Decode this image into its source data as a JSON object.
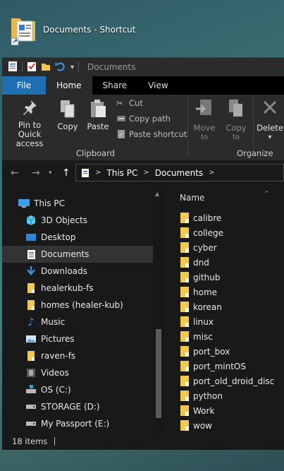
{
  "desktop": {
    "shortcut_label": "Documents - Shortcut"
  },
  "window": {
    "path_title": "Documents"
  },
  "tabs": [
    {
      "label": "File"
    },
    {
      "label": "Home"
    },
    {
      "label": "Share"
    },
    {
      "label": "View"
    }
  ],
  "ribbon": {
    "pin": "Pin to Quick access",
    "copy": "Copy",
    "paste": "Paste",
    "cut": "Cut",
    "copy_path": "Copy path",
    "paste_shortcut": "Paste shortcut",
    "clipboard": "Clipboard",
    "move_to": "Move",
    "move_to2": "to",
    "copy_to": "Copy",
    "copy_to2": "to",
    "delete": "Delete",
    "organize": "Organize"
  },
  "breadcrumb": [
    "This PC",
    "Documents"
  ],
  "tree": [
    {
      "label": "This PC",
      "icon": "pc-icon"
    },
    {
      "label": "3D Objects",
      "icon": "3d-objects-icon"
    },
    {
      "label": "Desktop",
      "icon": "desktop-icon"
    },
    {
      "label": "Documents",
      "icon": "documents-icon"
    },
    {
      "label": "Downloads",
      "icon": "download-icon"
    },
    {
      "label": "healerkub-fs",
      "icon": "folder-icon"
    },
    {
      "label": "homes (healer-kub)",
      "icon": "folder-icon"
    },
    {
      "label": "Music",
      "icon": "music-icon"
    },
    {
      "label": "Pictures",
      "icon": "pictures-icon"
    },
    {
      "label": "raven-fs",
      "icon": "folder-icon"
    },
    {
      "label": "Videos",
      "icon": "videos-icon"
    },
    {
      "label": "OS (C:)",
      "icon": "drive-os-icon"
    },
    {
      "label": "STORAGE (D:)",
      "icon": "drive-icon"
    },
    {
      "label": "My Passport (E:)",
      "icon": "drive-icon"
    }
  ],
  "column": {
    "name": "Name"
  },
  "files": [
    "calibre",
    "college",
    "cyber",
    "dnd",
    "github",
    "home",
    "korean",
    "linux",
    "misc",
    "port_box",
    "port_mintOS",
    "port_old_droid_disc",
    "python",
    "Work",
    "wow"
  ],
  "status": {
    "items": "18 items"
  },
  "colors": {
    "accent": "#1f6fb2",
    "folder": "#f2c94c",
    "background": "#191919"
  }
}
